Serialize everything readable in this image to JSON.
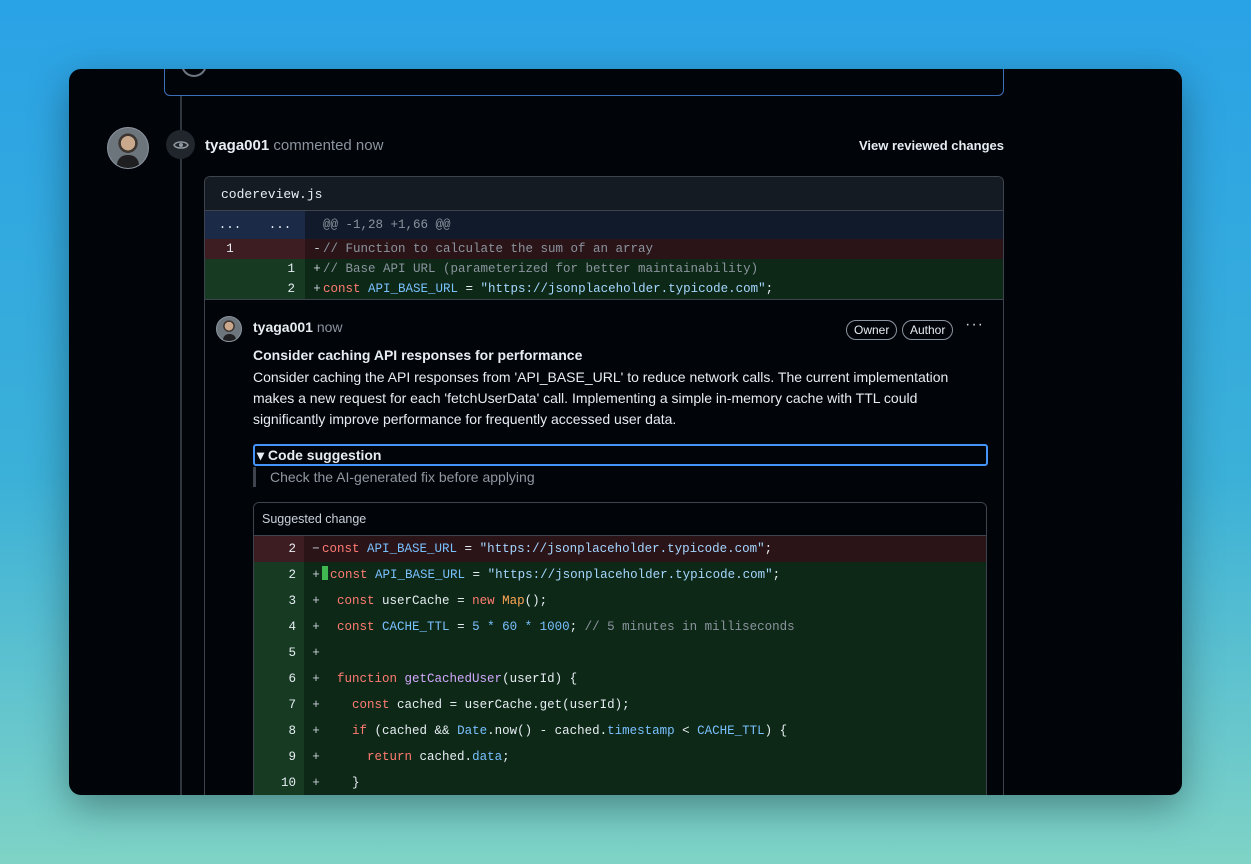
{
  "comment": {
    "author": "tyaga001",
    "action": "commented now",
    "view_link": "View reviewed changes"
  },
  "diff": {
    "filename": "codereview.js",
    "hunk_left": "...",
    "hunk_right": "...",
    "hunk_header": "@@ -1,28 +1,66 @@",
    "lines": [
      {
        "old": "1",
        "new": "",
        "sign": "-",
        "text": "// Function to calculate the sum of an array"
      },
      {
        "old": "",
        "new": "1",
        "sign": "+",
        "text": "// Base API URL (parameterized for better maintainability)"
      },
      {
        "old": "",
        "new": "2",
        "sign": "+",
        "p1": "const ",
        "p2": "API_BASE_URL",
        "p3": " = ",
        "p4": "\"https://jsonplaceholder.typicode.com\"",
        "p5": ";"
      }
    ]
  },
  "thread": {
    "author": "tyaga001",
    "time": "now",
    "badges": [
      "Owner",
      "Author"
    ],
    "menu": "···",
    "title": "Consider caching API responses for performance",
    "body": "Consider caching the API responses from 'API_BASE_URL' to reduce network calls. The current implementation makes a new request for each 'fetchUserData' call. Implementing a simple in-memory cache with TTL could significantly improve performance for frequently accessed user data.",
    "summary": "▾ Code suggestion",
    "note": "Check the AI-generated fix before applying",
    "suggestion_header": "Suggested change"
  },
  "suggestion": {
    "lines": [
      {
        "n": "2",
        "sign": "−"
      },
      {
        "n": "2",
        "sign": "+"
      },
      {
        "n": "3",
        "sign": "+"
      },
      {
        "n": "4",
        "sign": "+"
      },
      {
        "n": "5",
        "sign": "+"
      },
      {
        "n": "6",
        "sign": "+"
      },
      {
        "n": "7",
        "sign": "+"
      },
      {
        "n": "8",
        "sign": "+"
      },
      {
        "n": "9",
        "sign": "+"
      },
      {
        "n": "10",
        "sign": "+"
      }
    ],
    "tokens": {
      "const": "const",
      "api": "API_BASE_URL",
      "eq": " = ",
      "url": "\"https://jsonplaceholder.typicode.com\"",
      "semi": ";",
      "usercache": "userCache",
      "new": "new",
      "map": "Map",
      "mapcall": "();",
      "ttl": "CACHE_TTL",
      "ttlval": "5 * 60 * 1000",
      "ttlcomment": "// 5 minutes in milliseconds",
      "function": "function",
      "fnname": "getCachedUser",
      "fnargs": "(userId) {",
      "cached": "cached",
      "getcall": "userCache.get(userId);",
      "if": "if",
      "cond1": "(cached && ",
      "date": "Date",
      "cond2": ".now() - cached.",
      "timestamp": "timestamp",
      "lt": " < ",
      "cond3": ") {",
      "return": "return",
      "ret1": "cached.",
      "data": "data",
      "close": "}"
    }
  }
}
